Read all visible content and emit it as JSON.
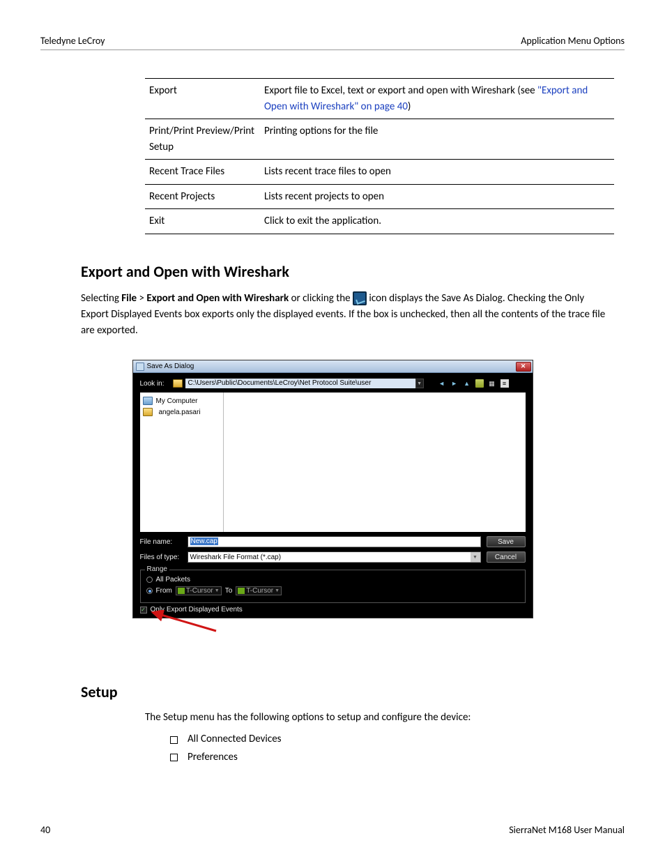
{
  "header": {
    "left": "Teledyne LeCroy",
    "right": "Application Menu Options"
  },
  "table": {
    "rows": [
      {
        "name": "Export",
        "desc_prefix": "Export file to Excel, text or export and open with Wireshark (see ",
        "desc_link": "\"Export and Open with Wireshark\" on page 40",
        "desc_suffix": ")"
      },
      {
        "name": "Print/Print Preview/Print Setup",
        "desc": "Printing options for the file"
      },
      {
        "name": "Recent Trace Files",
        "desc": "Lists recent trace files to open"
      },
      {
        "name": "Recent Projects",
        "desc": "Lists recent projects to open"
      },
      {
        "name": "Exit",
        "desc": "Click to exit the application."
      }
    ]
  },
  "section1": {
    "heading": "Export and Open with Wireshark",
    "p_pre": "Selecting ",
    "p_bold1": "File",
    "p_sep": " > ",
    "p_bold2": "Export and Open with Wireshark",
    "p_mid": " or clicking the ",
    "p_post": " icon displays the Save As Dialog. Checking the Only Export Displayed Events box exports only the displayed events. If the box is unchecked, then all the contents of the trace file are exported."
  },
  "dialog": {
    "title": "Save As Dialog",
    "lookin_label": "Look in:",
    "path": "C:\\Users\\Public\\Documents\\LeCroy\\Net Protocol Suite\\user",
    "sidebar": {
      "item1": "My Computer",
      "item2": "angela.pasari"
    },
    "filename_label": "File name:",
    "filename_value": "New.cap",
    "filetype_label": "Files of type:",
    "filetype_value": "Wireshark File Format (*.cap)",
    "save": "Save",
    "cancel": "Cancel",
    "range_legend": "Range",
    "all_packets": "All Packets",
    "from": "From",
    "to": "To",
    "cursor": "T-Cursor",
    "only_export": "Only Export Displayed Events"
  },
  "setup": {
    "heading": "Setup",
    "intro": "The Setup menu has the following options to setup and configure the device:",
    "items": [
      "All Connected Devices",
      "Preferences"
    ]
  },
  "footer": {
    "left": "40",
    "right": "SierraNet M168 User Manual"
  }
}
